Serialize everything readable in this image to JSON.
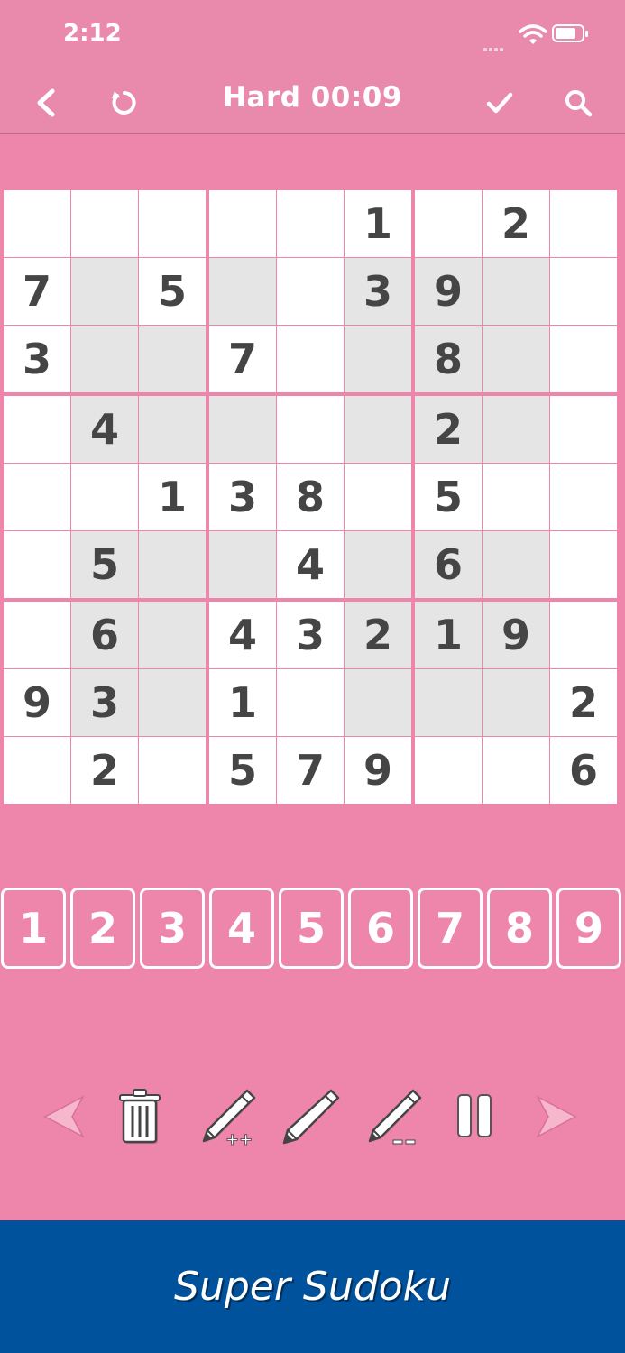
{
  "status": {
    "time": "2:12"
  },
  "nav": {
    "title": "Hard 00:09"
  },
  "board": [
    [
      "",
      "",
      "",
      "",
      "",
      "1",
      "",
      "2",
      ""
    ],
    [
      "7",
      "",
      "5",
      "",
      "",
      "3",
      "9",
      "",
      ""
    ],
    [
      "3",
      "",
      "",
      "7",
      "",
      "",
      "8",
      "",
      ""
    ],
    [
      "",
      "4",
      "",
      "",
      "",
      "",
      "2",
      "",
      ""
    ],
    [
      "",
      "",
      "1",
      "3",
      "8",
      "",
      "5",
      "",
      ""
    ],
    [
      "",
      "5",
      "",
      "",
      "4",
      "",
      "6",
      "",
      ""
    ],
    [
      "",
      "6",
      "",
      "4",
      "3",
      "2",
      "1",
      "9",
      ""
    ],
    [
      "9",
      "3",
      "",
      "1",
      "",
      "",
      "",
      "",
      "2"
    ],
    [
      "",
      "2",
      "",
      "5",
      "7",
      "9",
      "",
      "",
      "6"
    ]
  ],
  "shaded_cells": [
    [
      1,
      1
    ],
    [
      1,
      3
    ],
    [
      1,
      5
    ],
    [
      1,
      6
    ],
    [
      1,
      7
    ],
    [
      2,
      1
    ],
    [
      2,
      2
    ],
    [
      2,
      5
    ],
    [
      2,
      6
    ],
    [
      2,
      7
    ],
    [
      3,
      1
    ],
    [
      3,
      2
    ],
    [
      3,
      3
    ],
    [
      3,
      5
    ],
    [
      3,
      6
    ],
    [
      3,
      7
    ],
    [
      5,
      1
    ],
    [
      5,
      2
    ],
    [
      5,
      3
    ],
    [
      5,
      5
    ],
    [
      5,
      6
    ],
    [
      5,
      7
    ],
    [
      6,
      1
    ],
    [
      6,
      2
    ],
    [
      6,
      5
    ],
    [
      6,
      6
    ],
    [
      6,
      7
    ],
    [
      7,
      1
    ],
    [
      7,
      2
    ],
    [
      7,
      5
    ],
    [
      7,
      6
    ],
    [
      7,
      7
    ]
  ],
  "keypad": [
    "1",
    "2",
    "3",
    "4",
    "5",
    "6",
    "7",
    "8",
    "9"
  ],
  "tools": [
    {
      "name": "previous-arrow-icon"
    },
    {
      "name": "trash-icon"
    },
    {
      "name": "pencil-add-notes-icon"
    },
    {
      "name": "pencil-icon"
    },
    {
      "name": "pencil-remove-notes-icon"
    },
    {
      "name": "pause-icon"
    },
    {
      "name": "next-arrow-icon"
    }
  ],
  "footer": {
    "brand": "Super Sudoku"
  },
  "colors": {
    "background": "#ee85ab",
    "header": "#e98aad",
    "cell_shade": "#e5e5e5",
    "digit": "#454545",
    "footer": "#00529c"
  }
}
